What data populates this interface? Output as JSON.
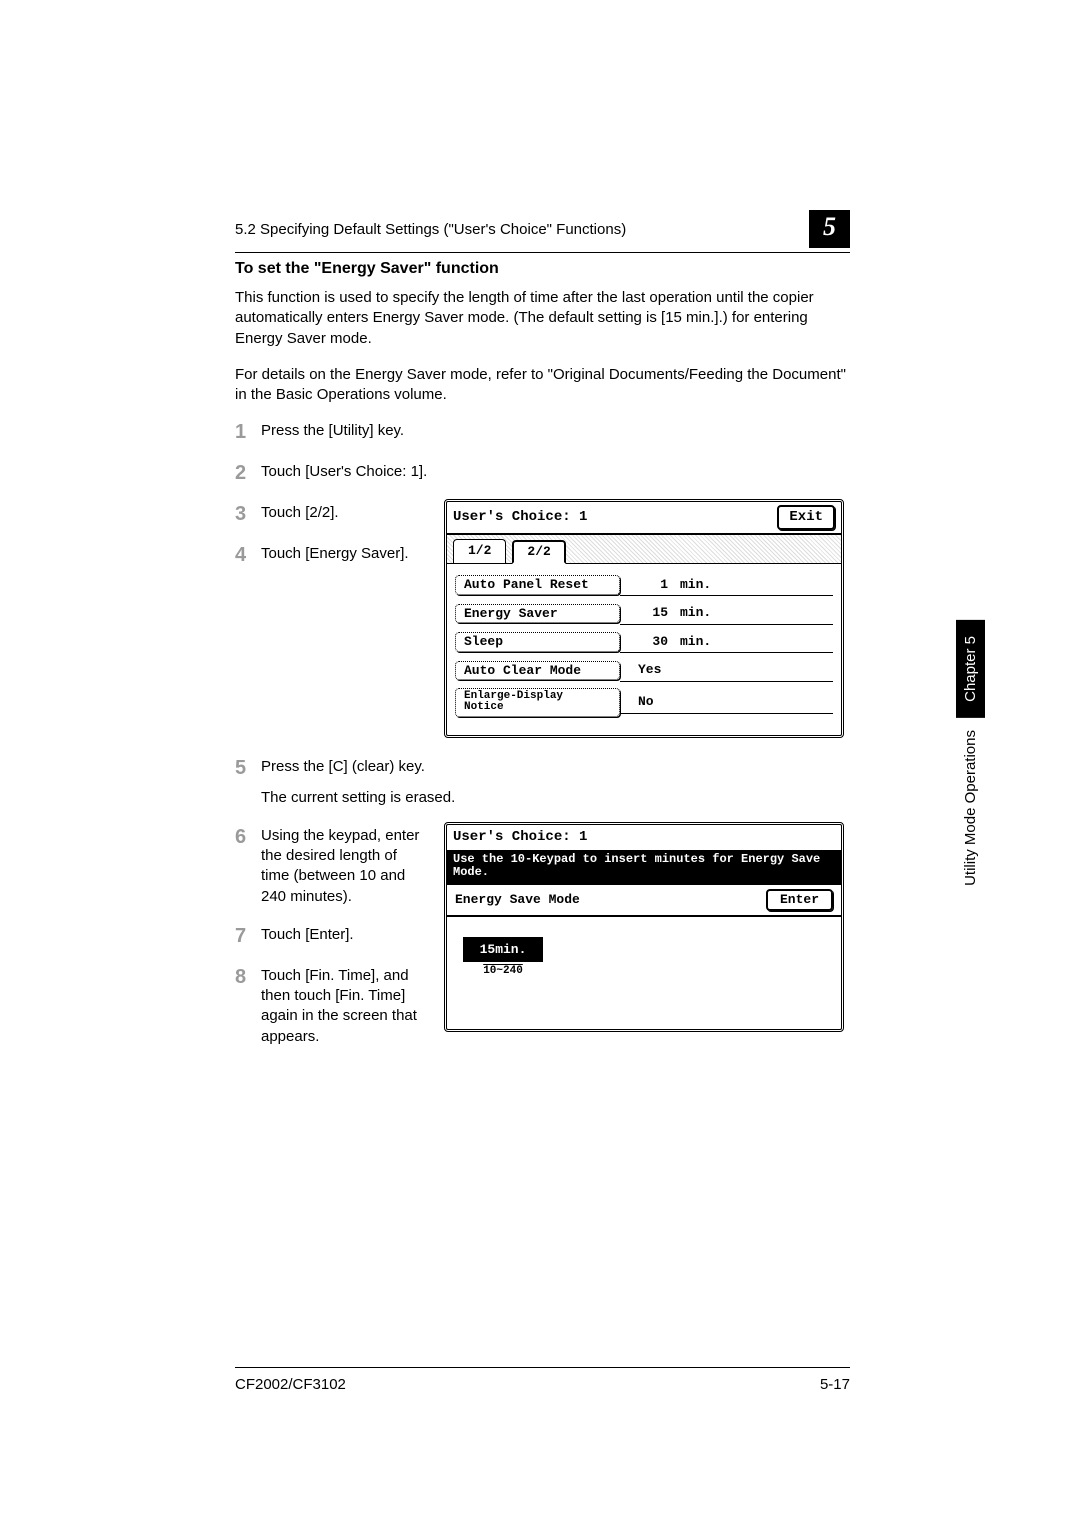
{
  "header": {
    "section": "5.2 Specifying Default Settings (\"User's Choice\" Functions)",
    "chapter_box": "5"
  },
  "side": {
    "chapter": "Chapter 5",
    "section": "Utility Mode Operations"
  },
  "heading": "To set the \"Energy Saver\" function",
  "para1": "This function is used to specify the length of time after the last operation until the copier automatically enters Energy Saver mode. (The default setting is [15 min.].) for entering Energy Saver mode.",
  "para2": "For details on the Energy Saver mode, refer to \"Original Documents/Feeding the Document\" in the Basic Operations volume.",
  "steps": {
    "s1": "Press the [Utility] key.",
    "s2": "Touch [User's Choice: 1].",
    "s3": "Touch [2/2].",
    "s4": "Touch [Energy Saver].",
    "s5a": "Press the [C] (clear) key.",
    "s5b": "The current setting is erased.",
    "s6": "Using the keypad, enter the desired length of time (between 10 and 240 minutes).",
    "s7": "Touch [Enter].",
    "s8": "Touch [Fin. Time], and then touch [Fin. Time] again in the screen that appears."
  },
  "lcd1": {
    "title": "User's Choice: 1",
    "exit": "Exit",
    "tab1": "1/2",
    "tab2": "2/2",
    "rows": [
      {
        "label": "Auto Panel Reset",
        "num": "1",
        "unit": "min."
      },
      {
        "label": "Energy Saver",
        "num": "15",
        "unit": "min."
      },
      {
        "label": "Sleep",
        "num": "30",
        "unit": "min."
      },
      {
        "label": "Auto Clear Mode",
        "num": "Yes",
        "unit": ""
      },
      {
        "label": "Enlarge-Display\nNotice",
        "num": "No",
        "unit": ""
      }
    ]
  },
  "lcd2": {
    "title": "User's Choice: 1",
    "msg": "Use the 10-Keypad to insert minutes for Energy Save Mode.",
    "mode": "Energy Save Mode",
    "enter": "Enter",
    "value": "15min.",
    "range": "10~240"
  },
  "footer": {
    "left": "CF2002/CF3102",
    "right": "5-17"
  }
}
